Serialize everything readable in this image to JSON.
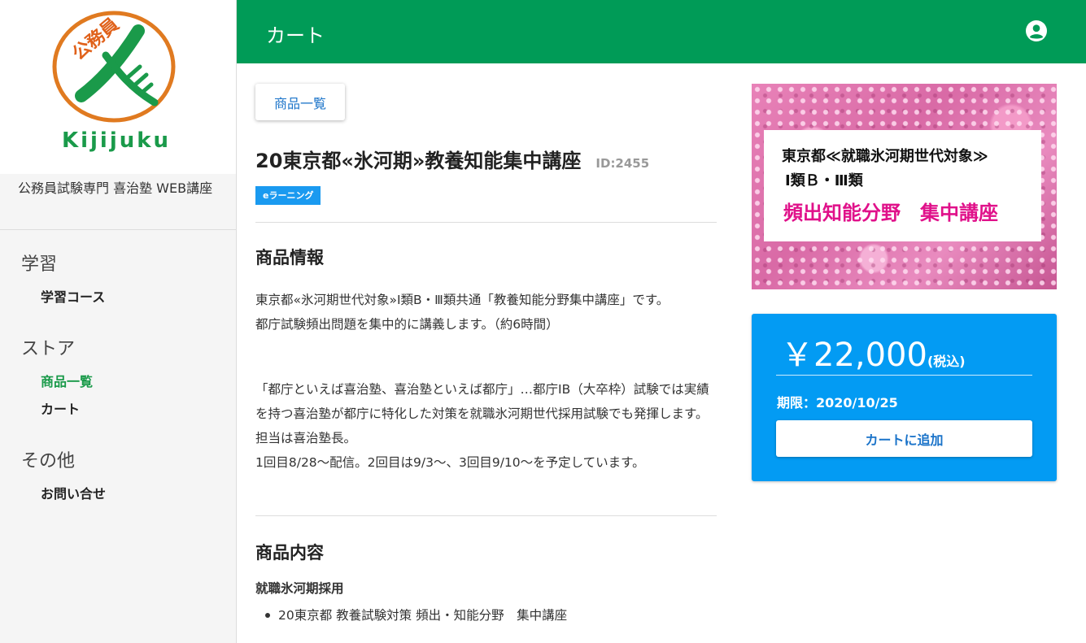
{
  "sidebar": {
    "logo_text": "Kijijuku",
    "logo_mark_text": "公務員",
    "site_name": "公務員試験専門 喜治塾 WEB講座",
    "sections": [
      {
        "title": "学習",
        "items": [
          {
            "label": "学習コース"
          }
        ]
      },
      {
        "title": "ストア",
        "items": [
          {
            "label": "商品一覧"
          },
          {
            "label": "カート"
          }
        ]
      },
      {
        "title": "その他",
        "items": [
          {
            "label": "お問い合せ"
          }
        ]
      }
    ]
  },
  "header": {
    "title": "カート",
    "account_icon": "account-circle-icon"
  },
  "main": {
    "back_button_label": "商品一覧",
    "product_title": "20東京都«氷河期»教養知能集中講座",
    "product_id": "ID:2455",
    "badge": "eラーニング",
    "info_heading": "商品情報",
    "info_paragraph1_line1": "東京都«氷河期世代対象»Ⅰ類B・Ⅲ類共通「教養知能分野集中講座」です。",
    "info_paragraph1_line2": "都庁試験頻出問題を集中的に講義します。（約6時間）",
    "info_paragraph2_line1": "「都庁といえば喜治塾、喜治塾といえば都庁」…都庁ⅠB（大卒枠）試験では実績を持つ喜治塾が都庁に特化した対策を就職氷河期世代採用試験でも発揮します。",
    "info_paragraph2_line2": "担当は喜治塾長。",
    "info_paragraph2_line3": "1回目8/28～配信。2回目は9/3～、3回目9/10～を予定しています。",
    "content_heading": "商品内容",
    "content_subheading": "就職氷河期採用",
    "content_items": [
      "20東京都 教養試験対策 頻出・知能分野　集中講座"
    ]
  },
  "banner": {
    "line1": "東京都≪就職氷河期世代対象≫",
    "line2": "Ⅰ類Ｂ・Ⅲ類",
    "line3": "頻出知能分野　集中講座"
  },
  "price_card": {
    "price": "￥22,000",
    "tax_label": "(税込)",
    "deadline": "期限：2020/10/25",
    "add_to_cart_label": "カートに追加"
  },
  "colors": {
    "header_green": "#009b57",
    "accent_blue": "#039bf3",
    "banner_pink": "#e0118a"
  }
}
